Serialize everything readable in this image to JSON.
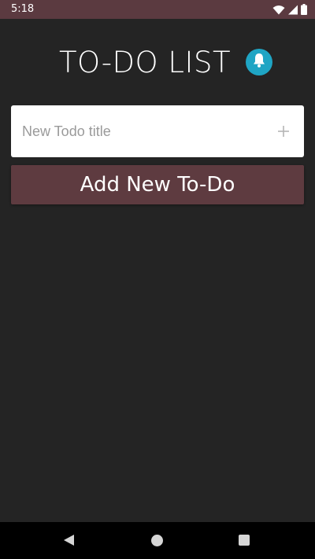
{
  "status_bar": {
    "time": "5:18",
    "icons": [
      "wifi-icon",
      "cellular-signal-icon",
      "battery-icon"
    ]
  },
  "header": {
    "title": "TO-DO LIST",
    "bell_icon": "bell-icon"
  },
  "todo_form": {
    "input_value": "",
    "input_placeholder": "New Todo title",
    "add_icon": "plus-icon",
    "add_button_label": "Add New To-Do"
  },
  "nav_bar": {
    "icons": [
      "back-icon",
      "home-icon",
      "recents-icon"
    ]
  },
  "colors": {
    "background": "#242424",
    "status_bar": "#5b3a40",
    "button": "#5e3b40",
    "bell_accent": "#1fa5c4",
    "input_background": "#ffffff"
  }
}
